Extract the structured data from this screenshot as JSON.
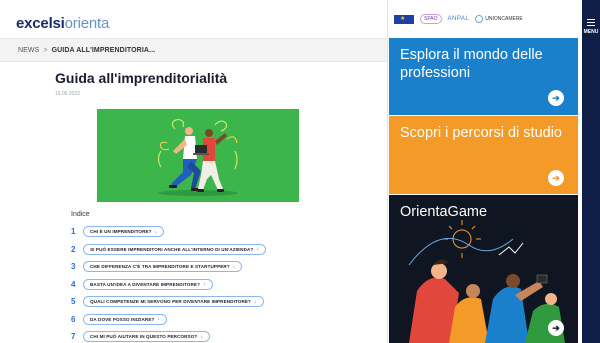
{
  "logo": {
    "part1": "excelsi",
    "part2": "orienta"
  },
  "breadcrumb": {
    "home": "NEWS",
    "separator": ">",
    "current": "GUIDA ALL'IMPRENDITORIA..."
  },
  "article": {
    "title": "Guida all'imprenditorialità",
    "date": "19.06.2022",
    "index_label": "Indice",
    "toc": [
      {
        "num": "1",
        "label": "CHI È UN IMPRENDITORE?"
      },
      {
        "num": "2",
        "label": "SI PUÒ ESSERE IMPRENDITORI ANCHE ALL'INTERNO DI UN'AZIENDA?"
      },
      {
        "num": "3",
        "label": "CHE DIFFERENZA C'È TRA IMPRENDITORE E STARTUPPER?"
      },
      {
        "num": "4",
        "label": "BASTA UN'IDEA A DIVENTARE IMPRENDITORE?"
      },
      {
        "num": "5",
        "label": "QUALI COMPETENZE MI SERVONO PER DIVENTARE IMPRENDITORE?"
      },
      {
        "num": "6",
        "label": "DA DOVE POSSO INIZIARE?"
      },
      {
        "num": "7",
        "label": "CHI MI PUÒ AIUTARE IN QUESTO PERCORSO?"
      }
    ],
    "toc_arrow": "↓"
  },
  "partners": {
    "spao": "SPAO",
    "anpal": "ANPAL",
    "unioncamere": "UNIONCAMERE"
  },
  "cards": [
    {
      "title": "Esplora il mondo delle professioni",
      "color": "#1b80cc"
    },
    {
      "title": "Scopri i percorsi di studio",
      "color": "#f39a28"
    },
    {
      "title": "OrientaGame",
      "color": "#0f1622"
    }
  ],
  "card_arrow": "➔",
  "menu": {
    "label": "MENU"
  },
  "colors": {
    "brand_navy": "#1a2b6b",
    "accent_blue": "#2f6bd8",
    "hero_green": "#3cb54a",
    "menu_bg": "#0e1e46"
  }
}
